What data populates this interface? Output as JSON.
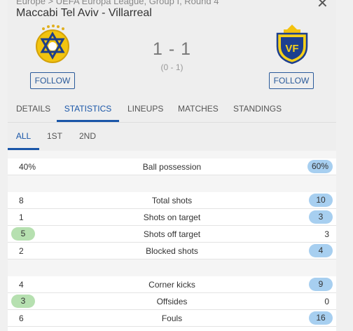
{
  "breadcrumb": "Europe > UEFA Europa League, Group I, Round 4",
  "match": {
    "title": "Maccabi Tel Aviv - Villarreal",
    "score": "1 - 1",
    "halftime": "(0 - 1)",
    "home_follow": "FOLLOW",
    "away_follow": "FOLLOW"
  },
  "tabs": [
    "DETAILS",
    "STATISTICS",
    "LINEUPS",
    "MATCHES",
    "STANDINGS"
  ],
  "subtabs": [
    "ALL",
    "1ST",
    "2ND"
  ],
  "stats": [
    {
      "label": "Ball possession",
      "home": "40%",
      "away": "60%",
      "hl": "away"
    },
    {
      "label": "Total shots",
      "home": "8",
      "away": "10",
      "hl": "away"
    },
    {
      "label": "Shots on target",
      "home": "1",
      "away": "3",
      "hl": "away"
    },
    {
      "label": "Shots off target",
      "home": "5",
      "away": "3",
      "hl": "home"
    },
    {
      "label": "Blocked shots",
      "home": "2",
      "away": "4",
      "hl": "away"
    },
    {
      "label": "Corner kicks",
      "home": "4",
      "away": "9",
      "hl": "away"
    },
    {
      "label": "Offsides",
      "home": "3",
      "away": "0",
      "hl": "home"
    },
    {
      "label": "Fouls",
      "home": "6",
      "away": "16",
      "hl": "away"
    }
  ],
  "colors": {
    "accent": "#1a56a8",
    "home_highlight": "#b6e0b0",
    "away_highlight": "#a7cff0"
  }
}
